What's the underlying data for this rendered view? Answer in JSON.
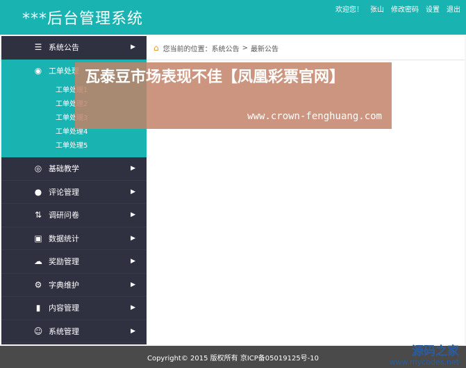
{
  "header": {
    "logo": "***后台管理系统",
    "links": [
      "欢迎您！",
      "张山",
      "修改密码",
      "设置",
      "退出"
    ]
  },
  "sidebar": {
    "items": [
      {
        "label": "系统公告",
        "icon": "news-icon"
      },
      {
        "label": "工单处理",
        "icon": "ticket-icon",
        "active": true,
        "subitems": [
          "工单处理1",
          "工单处理2",
          "工单处理3",
          "工单处理4",
          "工单处理5"
        ]
      },
      {
        "label": "基础教学",
        "icon": "target-icon"
      },
      {
        "label": "评论管理",
        "icon": "app-icon"
      },
      {
        "label": "调研问卷",
        "icon": "survey-icon"
      },
      {
        "label": "数据统计",
        "icon": "stats-icon"
      },
      {
        "label": "奖励管理",
        "icon": "cloud-icon"
      },
      {
        "label": "字典维护",
        "icon": "gear-icon"
      },
      {
        "label": "内容管理",
        "icon": "book-icon"
      },
      {
        "label": "系统管理",
        "icon": "user-admin-icon"
      }
    ]
  },
  "breadcrumb": {
    "prefix": "您当前的位置：",
    "path": [
      "系统公告",
      "最新公告"
    ],
    "separator": ">"
  },
  "overlay": {
    "title": "瓦泰豆市场表现不佳【凤凰彩票官网】",
    "url": "www.crown-fenghuang.com"
  },
  "footer": {
    "copyright": "Copyright© 2015 版权所有 京ICP备05019125号-10"
  },
  "watermark": {
    "name": "源码之家",
    "url": "www.mycodes.net"
  },
  "colors": {
    "accent": "#19b4b1",
    "sidebar_bg": "#2f3040",
    "footer_bg": "#4a4a4a"
  }
}
